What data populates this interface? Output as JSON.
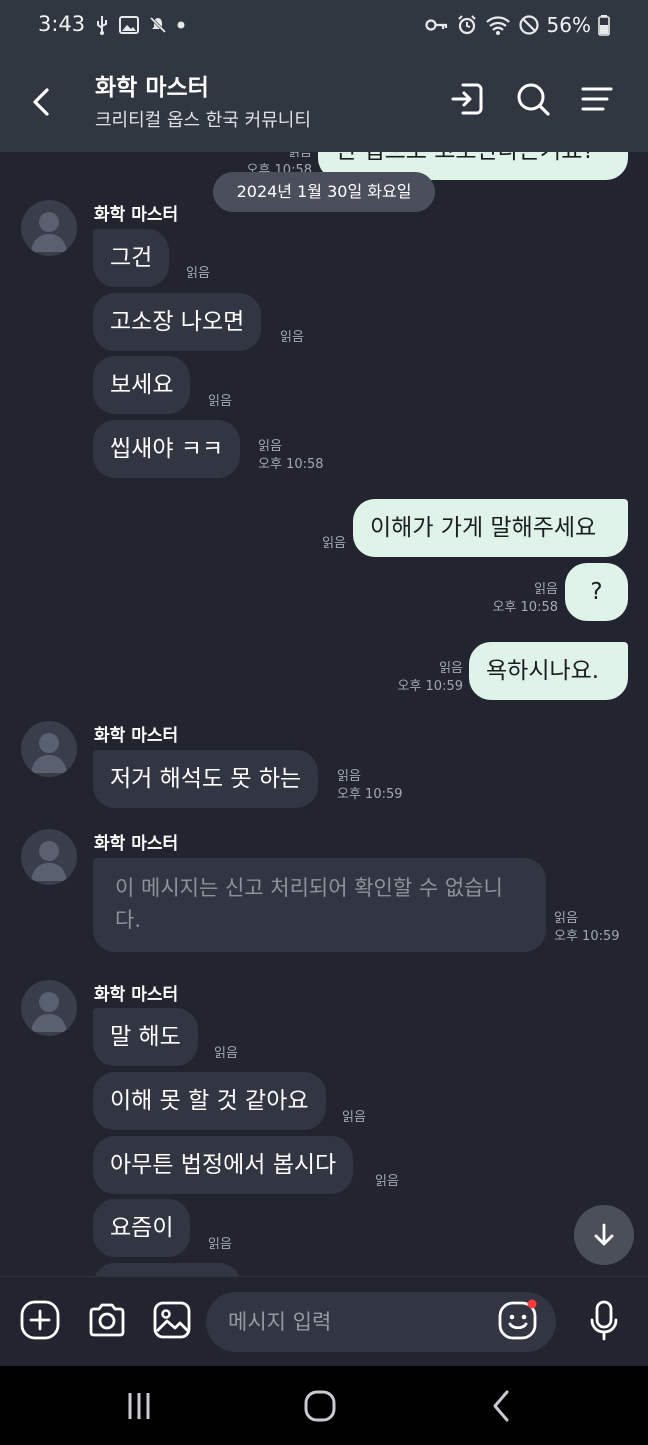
{
  "status": {
    "time": "3:43",
    "battery": "56%"
  },
  "header": {
    "title": "화학 마스터",
    "subtitle": "크리티컬 옵스 한국 커뮤니티"
  },
  "top_partial": {
    "text": "신 법으로 고소한다는거죠?",
    "read": "읽음",
    "time": "오후 10:58"
  },
  "date_divider": "2024년 1월 30일 화요일",
  "group1": {
    "sender": "화학 마스터",
    "messages": [
      {
        "text": "그건",
        "read": "읽음"
      },
      {
        "text": "고소장 나오면",
        "read": "읽음"
      },
      {
        "text": "보세요",
        "read": "읽음"
      },
      {
        "text": "씹새야 ㅋㅋ",
        "read": "읽음",
        "time": "오후 10:58"
      }
    ]
  },
  "outgoing": [
    {
      "text": "이해가 가게 말해주세요",
      "read": "읽음"
    },
    {
      "text": "?",
      "read": "읽음",
      "time": "오후 10:58"
    },
    {
      "text": "욕하시나요.",
      "read": "읽음",
      "time": "오후 10:59"
    }
  ],
  "group2": {
    "sender": "화학 마스터",
    "text": "저거 해석도 못 하는",
    "read": "읽음",
    "time": "오후 10:59"
  },
  "group3": {
    "sender": "화학 마스터",
    "text": "이 메시지는 신고 처리되어 확인할 수 없습니다.",
    "read": "읽음",
    "time": "오후 10:59"
  },
  "group4": {
    "sender": "화학 마스터",
    "messages": [
      {
        "text": "말 해도",
        "read": "읽음"
      },
      {
        "text": "이해 못 할 것 같아요",
        "read": "읽음"
      },
      {
        "text": "아무튼 법정에서 봅시다",
        "read": "읽음"
      },
      {
        "text": "요즘이",
        "read": "읽음"
      }
    ]
  },
  "input": {
    "placeholder": "메시지 입력"
  },
  "colors": {
    "background": "#22252f",
    "header": "#313741",
    "incoming_bubble": "#313642",
    "outgoing_bubble": "#dff3e8",
    "notification_dot": "#ff3b3b"
  },
  "icons": [
    "back-icon",
    "enter-icon",
    "search-icon",
    "menu-icon",
    "add-icon",
    "camera-icon",
    "gallery-icon",
    "emoji-icon",
    "mic-icon",
    "arrow-down-icon",
    "nav-recents-icon",
    "nav-home-icon",
    "nav-back-icon"
  ]
}
